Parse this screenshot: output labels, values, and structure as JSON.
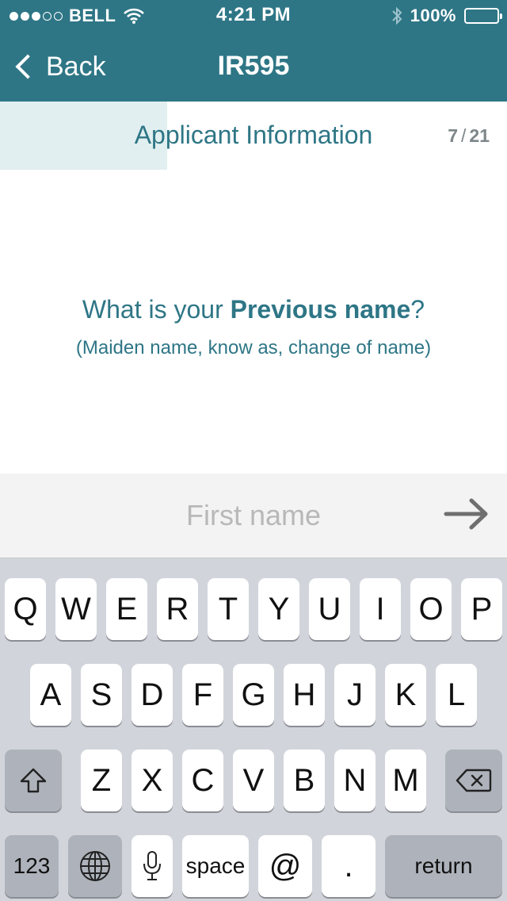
{
  "status_bar": {
    "carrier": "BELL",
    "signal": "3 of 5 dots",
    "time": "4:21 PM",
    "battery": "100%",
    "icons": [
      "wifi-icon",
      "bluetooth-icon",
      "battery-icon"
    ]
  },
  "nav": {
    "back_label": "Back",
    "title": "IR595"
  },
  "section": {
    "title": "Applicant Information",
    "step_current": "7",
    "step_separator": "/",
    "step_total": "21",
    "progress": 0.33
  },
  "question": {
    "prefix": "What is your ",
    "emphasis": "Previous name",
    "suffix": "?",
    "hint": "(Maiden name, know as, change of name)"
  },
  "input": {
    "placeholder": "First name",
    "value": ""
  },
  "keyboard": {
    "row1": [
      "Q",
      "W",
      "E",
      "R",
      "T",
      "Y",
      "U",
      "I",
      "O",
      "P"
    ],
    "row2": [
      "A",
      "S",
      "D",
      "F",
      "G",
      "H",
      "J",
      "K",
      "L"
    ],
    "row3": [
      "Z",
      "X",
      "C",
      "V",
      "B",
      "N",
      "M"
    ],
    "numbers_label": "123",
    "space_label": "space",
    "at_label": "@",
    "period_label": ".",
    "return_label": "return"
  },
  "colors": {
    "brand": "#2e7686",
    "progress_fill": "#e1eff0",
    "keyboard_bg": "#d1d5db"
  }
}
